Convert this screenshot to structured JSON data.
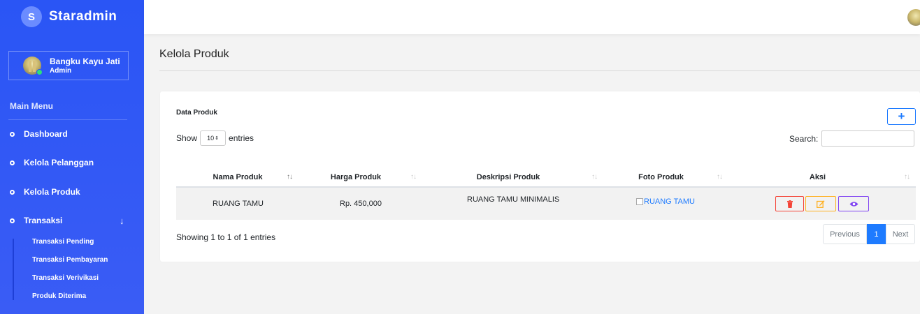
{
  "brand": {
    "logo_letter": "S",
    "name": "Staradmin"
  },
  "profile": {
    "name": "Bangku Kayu Jati",
    "role": "Admin"
  },
  "menu": {
    "title": "Main Menu",
    "items": [
      {
        "label": "Dashboard"
      },
      {
        "label": "Kelola Pelanggan"
      },
      {
        "label": "Kelola Produk"
      },
      {
        "label": "Transaksi"
      }
    ],
    "transaksi_chevron": "↓",
    "submenu": [
      {
        "label": "Transaksi Pending"
      },
      {
        "label": "Transaksi Pembayaran"
      },
      {
        "label": "Transaksi Verivikasi"
      },
      {
        "label": "Produk Diterima"
      }
    ]
  },
  "page": {
    "title": "Kelola Produk"
  },
  "card": {
    "title": "Data Produk",
    "add_label": "+",
    "show_label": "Show",
    "page_length": "10",
    "entries_label": "entries",
    "search_label": "Search:",
    "search_value": "",
    "columns": [
      "Nama Produk",
      "Harga Produk",
      "Deskripsi Produk",
      "Foto Produk",
      "Aksi"
    ],
    "sort_icon": "↑↓",
    "rows": [
      {
        "nama": "RUANG TAMU",
        "harga": "Rp. 450,000",
        "deskripsi": "RUANG TAMU MINIMALIS",
        "foto_alt": "RUANG TAMU"
      }
    ],
    "info": "Showing 1 to 1 of 1 entries",
    "pagination": {
      "previous": "Previous",
      "current": "1",
      "next": "Next"
    }
  },
  "colors": {
    "sidebar": "#2a55f5",
    "primary": "#1e7bff",
    "danger": "#f44336",
    "warning": "#ffb020",
    "info": "#8043f2"
  },
  "icons": [
    "trash-icon",
    "edit-icon",
    "eye-icon",
    "broken-image-icon"
  ]
}
